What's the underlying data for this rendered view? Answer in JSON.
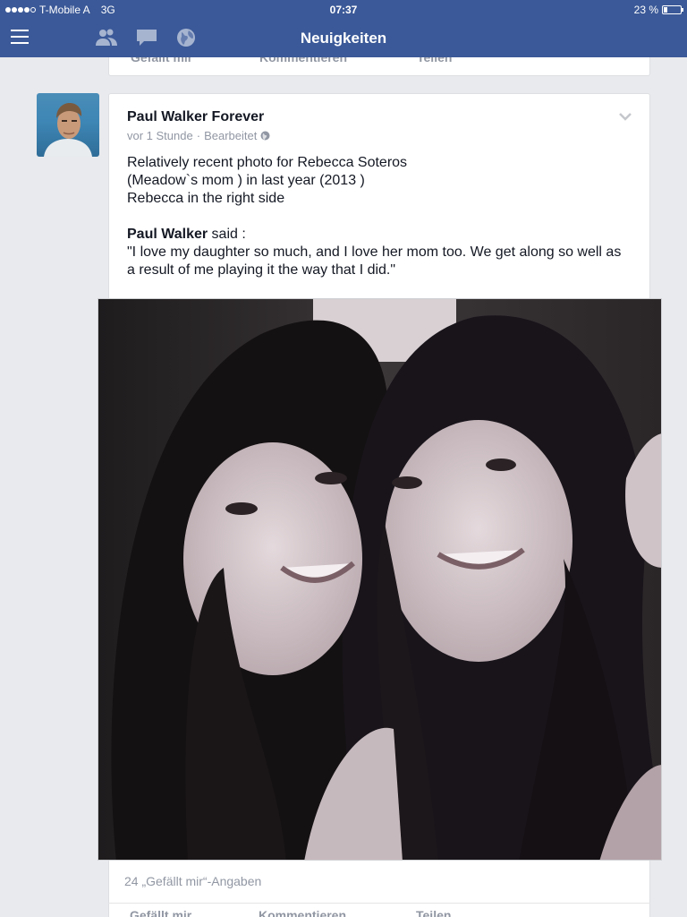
{
  "status_bar": {
    "carrier": "T-Mobile A",
    "network": "3G",
    "time": "07:37",
    "battery": "23 %",
    "battery_level": 0.23
  },
  "nav": {
    "title": "Neuigkeiten",
    "icons": [
      "menu-icon",
      "friends-icon",
      "messages-icon",
      "globe-icon"
    ]
  },
  "prev_post": {
    "actions": [
      "Gefällt mir",
      "Kommentieren",
      "Teilen"
    ]
  },
  "post": {
    "author": "Paul Walker Forever",
    "time": "vor 1 Stunde",
    "separator": "·",
    "edited": "Bearbeitet",
    "lines": [
      "Relatively recent photo for Rebecca Soteros",
      "(Meadow`s mom ) in last year (2013 )",
      "Rebecca in the right side"
    ],
    "quote_author": "Paul Walker",
    "quote_said": " said :",
    "quote_text": " \"I love my daughter so much, and I love her mom too. We get along so well as a result of me playing it the way that I did.\"",
    "likes": "24 „Gefällt mir“-Angaben"
  },
  "colors": {
    "brand": "#3b5998",
    "background": "#e9eaed",
    "meta_text": "#9197a3"
  }
}
